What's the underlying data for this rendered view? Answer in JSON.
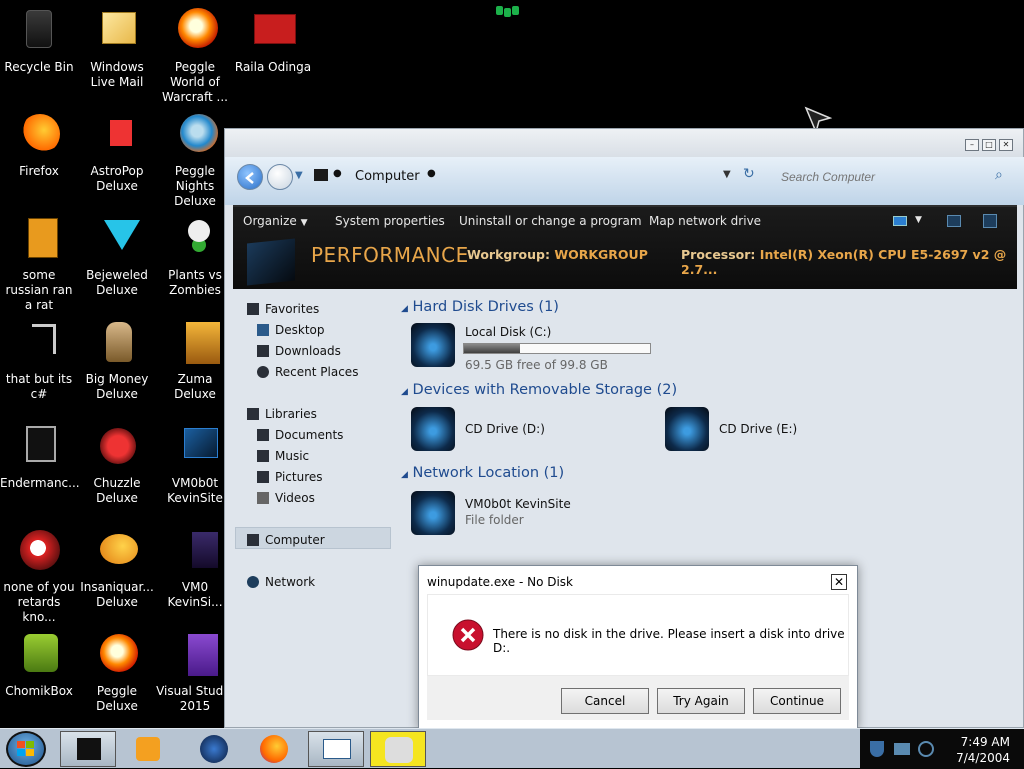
{
  "desktop": {
    "icons": [
      {
        "label": "Recycle Bin"
      },
      {
        "label": "Windows Live Mail"
      },
      {
        "label": "Peggle World of Warcraft ..."
      },
      {
        "label": "Raila Odinga"
      },
      {
        "label": "Firefox"
      },
      {
        "label": "AstroPop Deluxe"
      },
      {
        "label": "Peggle Nights Deluxe"
      },
      {
        "label": "some russian ran a rat"
      },
      {
        "label": "Bejeweled Deluxe"
      },
      {
        "label": "Plants vs Zombies"
      },
      {
        "label": "that but its c#"
      },
      {
        "label": "Big Money Deluxe"
      },
      {
        "label": "Zuma Deluxe"
      },
      {
        "label": "Endermanc..."
      },
      {
        "label": "Chuzzle Deluxe"
      },
      {
        "label": "VM0b0t KevinSite"
      },
      {
        "label": "none of you retards kno..."
      },
      {
        "label": "Insaniquar... Deluxe"
      },
      {
        "label": "VM0 KevinSi..."
      },
      {
        "label": "ChomikBox"
      },
      {
        "label": "Peggle Deluxe"
      },
      {
        "label": "Visual Studio 2015"
      }
    ]
  },
  "explorer": {
    "breadcrumb": "Computer",
    "search_placeholder": "Search Computer",
    "toolbar": {
      "organize": "Organize",
      "system_properties": "System properties",
      "uninstall": "Uninstall or change a program",
      "map_drive": "Map network drive"
    },
    "banner": {
      "name": "PERFORMANCE",
      "workgroup_label": "Workgroup:",
      "workgroup_value": "WORKGROUP",
      "processor_label": "Processor:",
      "processor_value": "Intel(R) Xeon(R) CPU E5-2697 v2 @ 2.7..."
    },
    "nav": {
      "favorites": "Favorites",
      "desktop": "Desktop",
      "downloads": "Downloads",
      "recent": "Recent Places",
      "libraries": "Libraries",
      "documents": "Documents",
      "music": "Music",
      "pictures": "Pictures",
      "videos": "Videos",
      "computer": "Computer",
      "network": "Network"
    },
    "groups": {
      "hdd": "Hard Disk Drives (1)",
      "removable": "Devices with Removable Storage (2)",
      "network": "Network Location (1)"
    },
    "drives": {
      "c_name": "Local Disk (C:)",
      "c_free": "69.5 GB free of 99.8 GB",
      "c_used_fraction": 0.3,
      "d_name": "CD Drive (D:)",
      "e_name": "CD Drive (E:)",
      "net_name": "VM0b0t KevinSite",
      "net_type": "File folder"
    }
  },
  "dialog": {
    "title": "winupdate.exe - No Disk",
    "message": "There is no disk in the drive. Please insert a disk into drive D:.",
    "cancel": "Cancel",
    "try_again": "Try Again",
    "continue": "Continue"
  },
  "taskbar": {
    "time": "7:49 AM",
    "date": "7/4/2004"
  },
  "colors": {
    "banner_accent": "#e8a64a",
    "group_heading": "#1f4b8f",
    "error_red": "#c8102e"
  }
}
